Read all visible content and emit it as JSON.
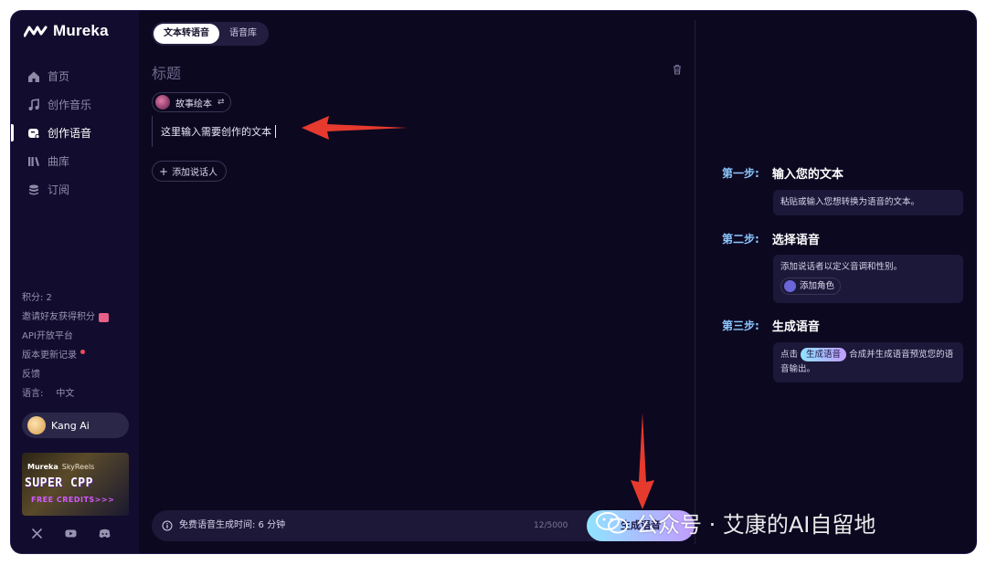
{
  "app": {
    "brand": "Mureka"
  },
  "sidebar": {
    "nav": [
      {
        "label": "首页",
        "icon": "home-icon",
        "active": false
      },
      {
        "label": "创作音乐",
        "icon": "music-note-icon",
        "active": false
      },
      {
        "label": "创作语音",
        "icon": "voice-icon",
        "active": true
      },
      {
        "label": "曲库",
        "icon": "library-icon",
        "active": false
      },
      {
        "label": "订阅",
        "icon": "subscription-icon",
        "active": false
      }
    ],
    "credits": "积分: 2",
    "invite": "邀请好友获得积分",
    "api": "API开放平台",
    "changelog": "版本更新记录",
    "feedback": "反馈",
    "language_label": "语言:",
    "language_value": "中文",
    "user_name": "Kang Ai",
    "promo": {
      "brand_left": "Mureka",
      "brand_right": "SkyReels",
      "title": "SUPER CPP",
      "subtitle": "FREE CREDITS>>>"
    },
    "socials": [
      "x-icon",
      "youtube-icon",
      "discord-icon"
    ]
  },
  "editor": {
    "tabs": [
      {
        "label": "文本转语音",
        "active": true
      },
      {
        "label": "语音库",
        "active": false
      }
    ],
    "title_placeholder": "标题",
    "speaker_name": "故事绘本",
    "swap_symbol": "⇄",
    "text": "这里输入需要创作的文本",
    "add_speaker": "添加说话人",
    "free_time": "免费语音生成时间: 6 分钟",
    "counter": "12/5000",
    "generate": "生成语音"
  },
  "guide": {
    "steps": [
      {
        "label": "第一步:",
        "title": "输入您的文本",
        "desc": "粘贴或输入您想转换为语音的文本。"
      },
      {
        "label": "第二步:",
        "title": "选择语音",
        "desc": "添加说话者以定义音调和性别。",
        "chip": "添加角色"
      },
      {
        "label": "第三步:",
        "title": "生成语音",
        "desc_before": "点击",
        "pill": "生成语音",
        "desc_after": "合成并生成语音预览您的语音输出。"
      }
    ]
  },
  "watermark": {
    "text": "公众号 · 艾康的AI自留地"
  },
  "colors": {
    "background": "#0c0820",
    "sidebar": "#120d2e",
    "accent_blue": "#8cc7ff",
    "gradient_start": "#8fe3ff",
    "gradient_end": "#c29cff",
    "annotation_red": "#e63a2e"
  }
}
